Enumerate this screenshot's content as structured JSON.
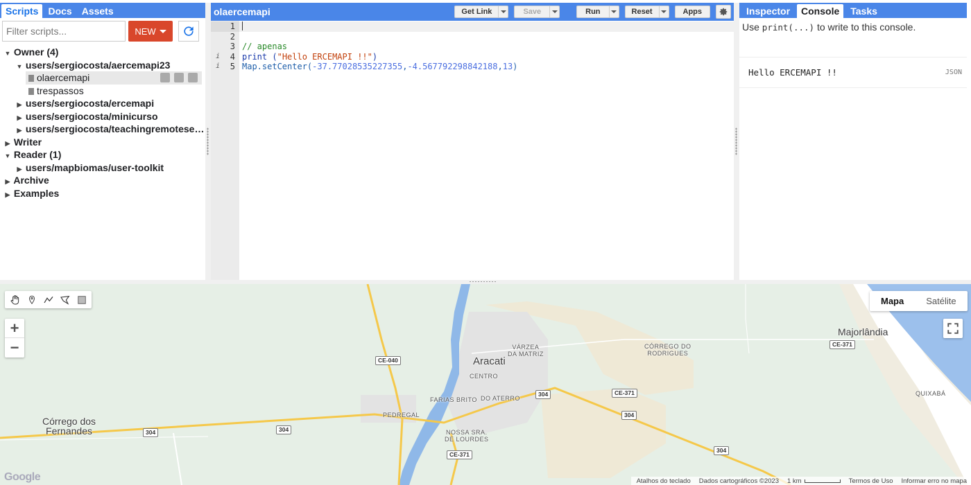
{
  "left_panel": {
    "tabs": [
      "Scripts",
      "Docs",
      "Assets"
    ],
    "filter_placeholder": "Filter scripts...",
    "new_label": "NEW",
    "tree": {
      "owner": "Owner (4)",
      "repo_aercemapi23": "users/sergiocosta/aercemapi23",
      "file_olaercemapi": "olaercemapi",
      "file_trespassos": "trespassos",
      "repo_ercemapi": "users/sergiocosta/ercemapi",
      "repo_minicurso": "users/sergiocosta/minicurso",
      "repo_teaching": "users/sergiocosta/teachingremotesens...",
      "writer": "Writer",
      "reader": "Reader (1)",
      "repo_usertoolkit": "users/mapbiomas/user-toolkit",
      "archive": "Archive",
      "examples": "Examples"
    }
  },
  "editor": {
    "script_name": "olaercemapi",
    "get_link": "Get Link",
    "save": "Save",
    "run": "Run",
    "reset": "Reset",
    "apps": "Apps",
    "line_numbers": [
      "1",
      "2",
      "3",
      "4",
      "5"
    ],
    "code": {
      "line3": "// apenas",
      "line4_fn": "print ",
      "line4_open": "(",
      "line4_str": "\"Hello ERCEMAPI !!\"",
      "line4_close": ")",
      "line5_fn": "Map.setCenter(",
      "line5_lon": "-37.77028535227355",
      "line5_c1": ",",
      "line5_lat": "-4.567792298842188",
      "line5_c2": ",",
      "line5_zoom": "13",
      "line5_close": ")"
    }
  },
  "right_panel": {
    "tabs": [
      "Inspector",
      "Console",
      "Tasks"
    ],
    "hint_pre": "Use ",
    "hint_code": "print(...)",
    "hint_post": " to write to this console.",
    "output": "Hello ERCEMAPI !!",
    "json_label": "JSON"
  },
  "map": {
    "map_type_active": "Mapa",
    "map_type_other": "Satélite",
    "places": {
      "aracati": "Aracati",
      "majorlandia": "Majorlândia",
      "corrego_fernandes_1": "Córrego dos",
      "corrego_fernandes_2": "Fernandes"
    },
    "hoods": {
      "varzea_1": "VÁRZEA",
      "varzea_2": "DA MATRIZ",
      "corrego_rod_1": "CÓRREGO DO",
      "corrego_rod_2": "RODRIGUES",
      "centro": "CENTRO",
      "farias_brito": "FARIAS BRITO",
      "do_aterro": "DO ATERRO",
      "pedregal": "PEDREGAL",
      "nossa_sra_1": "NOSSA SRA.",
      "nossa_sra_2": "DE LOURDES",
      "quixaba": "QUIXABÁ"
    },
    "shields": {
      "ce040": "CE-040",
      "ce371_a": "CE-371",
      "ce371_b": "CE-371",
      "ce371_c": "CE-371",
      "r304_a": "304",
      "r304_b": "304",
      "r304_c": "304",
      "r304_d": "304",
      "r304_e": "304"
    },
    "google": "Google",
    "attribution": {
      "shortcuts": "Atalhos do teclado",
      "data": "Dados cartográficos ©2023",
      "scale": "1 km",
      "terms": "Termos de Uso",
      "report": "Informar erro no mapa"
    }
  },
  "colors": {
    "header_blue": "#4a86e8",
    "new_red": "#d9472b",
    "map_green": "#e6efe6",
    "water": "#8fb8e8",
    "road": "#f5c84a"
  }
}
